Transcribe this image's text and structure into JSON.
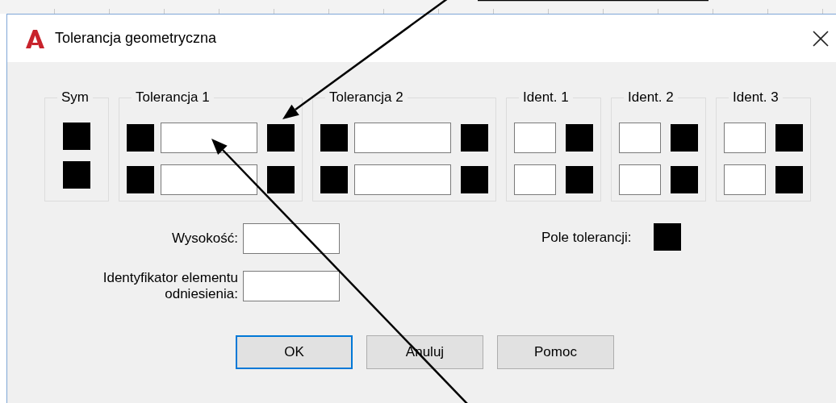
{
  "window": {
    "title": "Tolerancja geometryczna"
  },
  "groups": [
    {
      "label": "Sym",
      "rows": [
        [
          {
            "kind": "swatch"
          }
        ],
        [
          {
            "kind": "swatch"
          }
        ]
      ]
    },
    {
      "label": "Tolerancja 1",
      "rows": [
        [
          {
            "kind": "swatch"
          },
          {
            "kind": "field"
          },
          {
            "kind": "swatch"
          }
        ],
        [
          {
            "kind": "swatch"
          },
          {
            "kind": "field"
          },
          {
            "kind": "swatch"
          }
        ]
      ]
    },
    {
      "label": "Tolerancja 2",
      "rows": [
        [
          {
            "kind": "swatch"
          },
          {
            "kind": "field"
          },
          {
            "kind": "swatch"
          }
        ],
        [
          {
            "kind": "swatch"
          },
          {
            "kind": "field"
          },
          {
            "kind": "swatch"
          }
        ]
      ]
    },
    {
      "label": "Ident. 1",
      "rows": [
        [
          {
            "kind": "smallfield"
          },
          {
            "kind": "swatch"
          }
        ],
        [
          {
            "kind": "smallfield"
          },
          {
            "kind": "swatch"
          }
        ]
      ]
    },
    {
      "label": "Ident. 2",
      "rows": [
        [
          {
            "kind": "smallfield"
          },
          {
            "kind": "swatch"
          }
        ],
        [
          {
            "kind": "smallfield"
          },
          {
            "kind": "swatch"
          }
        ]
      ]
    },
    {
      "label": "Ident. 3",
      "rows": [
        [
          {
            "kind": "smallfield"
          },
          {
            "kind": "swatch"
          }
        ],
        [
          {
            "kind": "smallfield"
          },
          {
            "kind": "swatch"
          }
        ]
      ]
    }
  ],
  "fields": [
    {
      "label": "Wysokość:"
    },
    {
      "label": "Identyfikator elementu odniesienia:"
    }
  ],
  "tolerance_zone": {
    "label": "Pole tolerancji:"
  },
  "buttons": [
    {
      "label": "OK",
      "default": true
    },
    {
      "label": "Anuluj",
      "default": false
    },
    {
      "label": "Pomoc",
      "default": false
    }
  ]
}
